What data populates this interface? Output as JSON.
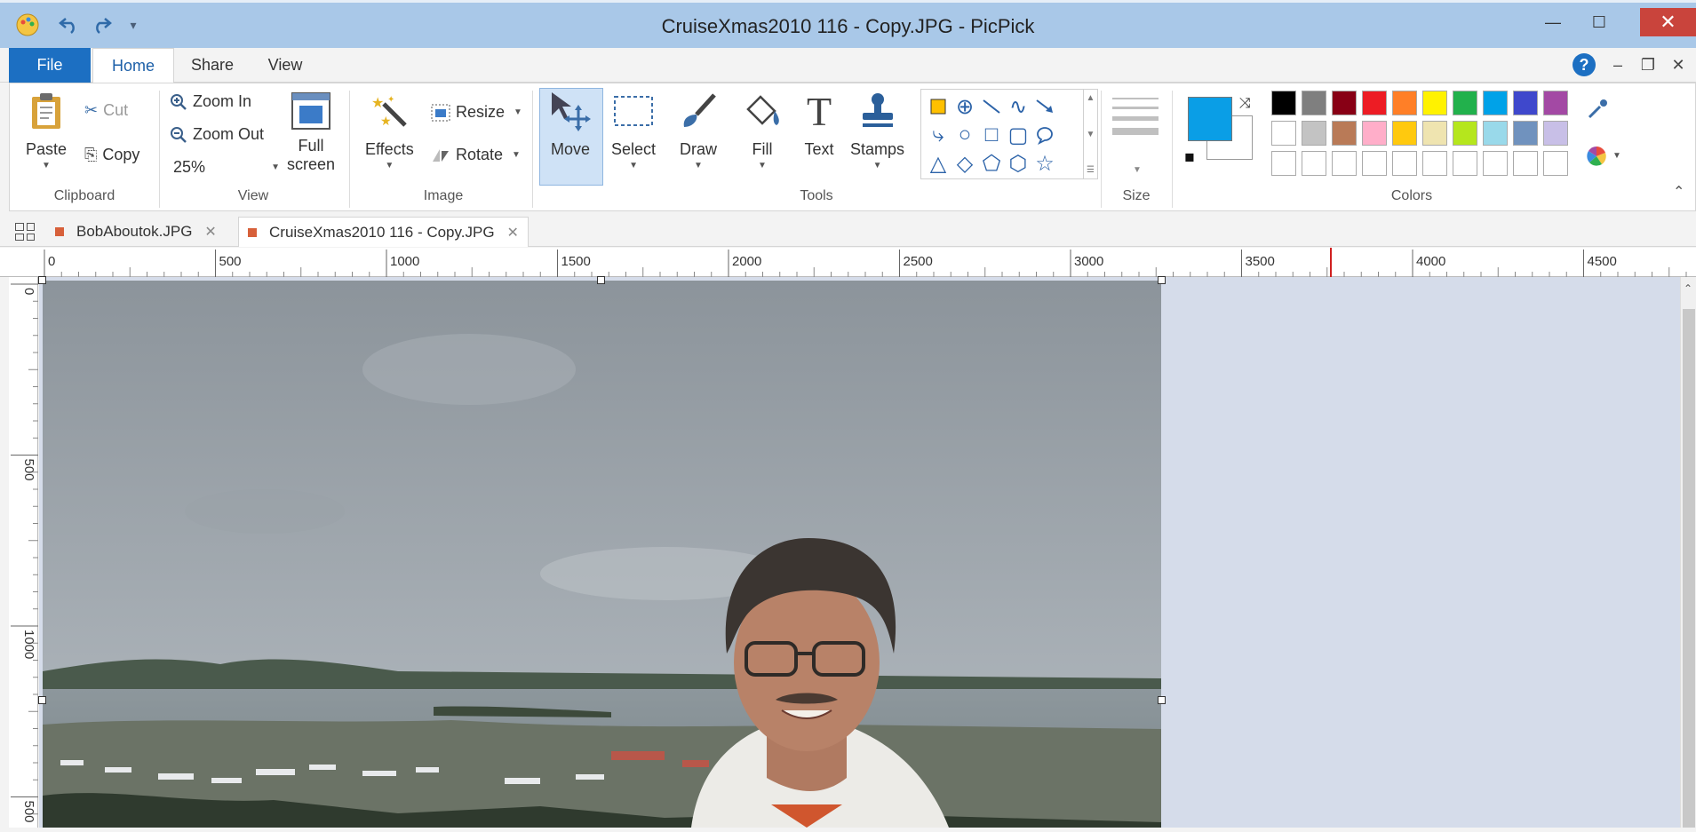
{
  "window": {
    "title": "CruiseXmas2010 116 - Copy.JPG - PicPick"
  },
  "ribbon_tabs": {
    "file": "File",
    "home": "Home",
    "share": "Share",
    "view": "View"
  },
  "clipboard": {
    "paste": "Paste",
    "cut": "Cut",
    "copy": "Copy",
    "group": "Clipboard"
  },
  "view": {
    "zoom_in": "Zoom In",
    "zoom_out": "Zoom Out",
    "zoom_level": "25%",
    "full_screen_1": "Full",
    "full_screen_2": "screen",
    "group": "View"
  },
  "image": {
    "effects": "Effects",
    "resize": "Resize",
    "rotate": "Rotate",
    "group": "Image"
  },
  "tools": {
    "move": "Move",
    "select": "Select",
    "draw": "Draw",
    "fill": "Fill",
    "text": "Text",
    "stamps": "Stamps",
    "group": "Tools"
  },
  "size": {
    "group": "Size"
  },
  "colors": {
    "group": "Colors",
    "primary": "#0a9ee6",
    "secondary": "#ffffff",
    "palette_row1": [
      "#000000",
      "#7f7f7f",
      "#880015",
      "#ed1c24",
      "#ff7f27",
      "#fff200",
      "#22b14c",
      "#00a2e8",
      "#3f48cc",
      "#a349a4"
    ],
    "palette_row2": [
      "#ffffff",
      "#c3c3c3",
      "#b97a57",
      "#ffaec9",
      "#ffc90e",
      "#efe4b0",
      "#b5e61d",
      "#99d9ea",
      "#7092be",
      "#c8bfe7"
    ]
  },
  "doc_tabs": [
    {
      "label": "BobAboutok.JPG"
    },
    {
      "label": "CruiseXmas2010 116 - Copy.JPG"
    }
  ],
  "ruler_h": [
    "0",
    "500",
    "1000",
    "1500",
    "2000",
    "2500",
    "3000",
    "3500",
    "4000",
    "4500"
  ],
  "ruler_v": [
    "0",
    "500",
    "1000",
    "500"
  ]
}
